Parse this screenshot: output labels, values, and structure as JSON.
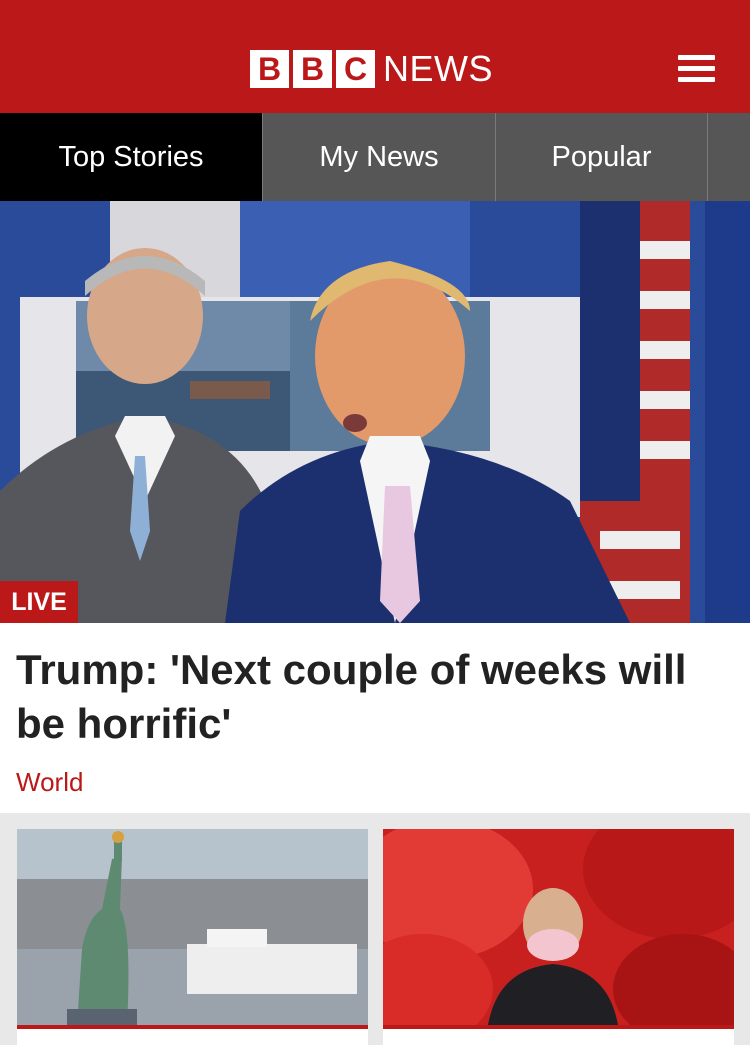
{
  "header": {
    "logo_letters": [
      "B",
      "B",
      "C"
    ],
    "logo_word": "NEWS",
    "brand_color": "#bb1919",
    "menu_icon": "hamburger-menu-icon"
  },
  "tabs": [
    {
      "label": "Top Stories",
      "active": true
    },
    {
      "label": "My News",
      "active": false
    },
    {
      "label": "Popular",
      "active": false
    },
    {
      "label": "",
      "active": false
    }
  ],
  "hero": {
    "badge": "LIVE",
    "headline": "Trump: 'Next couple of weeks will be horrific'",
    "section": "World"
  },
  "cards": [
    {
      "image": "statue-of-liberty-hospital-ship-photo"
    },
    {
      "image": "man-in-face-mask-red-lanterns-photo"
    }
  ]
}
